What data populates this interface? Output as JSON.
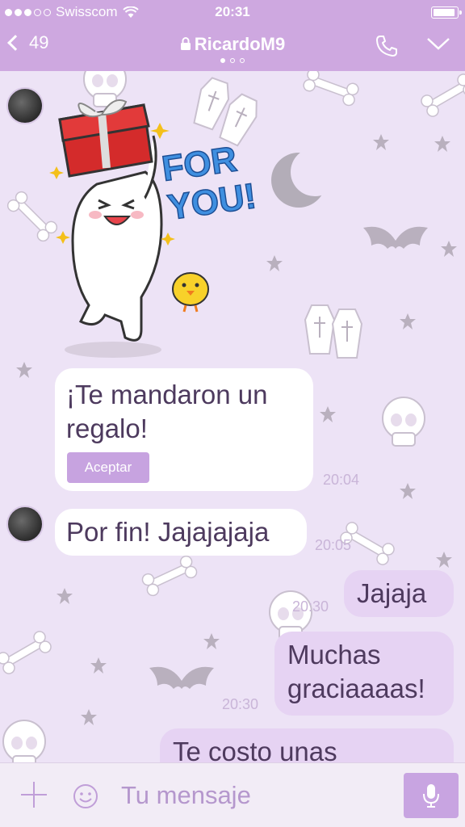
{
  "status_bar": {
    "carrier": "Swisscom",
    "time": "20:31",
    "signal_level": 3,
    "battery_level": 1.0
  },
  "nav": {
    "back_count": "49",
    "title": "RicardoM9",
    "page_count": 3,
    "page_active": 0
  },
  "messages": [
    {
      "type": "gift",
      "text": "¡Te mandaron un regalo!",
      "button": "Aceptar",
      "time": "20:04"
    },
    {
      "text": "Por fin! Jajajajaja",
      "time": "20:05"
    },
    {
      "text": "Jajaja",
      "time": "20:30"
    },
    {
      "text": "Muchas graciaaaas!",
      "time": "20:30"
    },
    {
      "text": "Te costo unas"
    }
  ],
  "sticker": {
    "label": "FOR YOU!"
  },
  "input": {
    "placeholder": "Tu mensaje"
  },
  "colors": {
    "header": "#cea8e0",
    "background": "#ede3f6",
    "accent": "#c8a4e1"
  },
  "icons": [
    "back-chevron-icon",
    "lock-icon",
    "phone-icon",
    "chevron-down-icon",
    "plus-icon",
    "smiley-icon",
    "microphone-icon"
  ]
}
